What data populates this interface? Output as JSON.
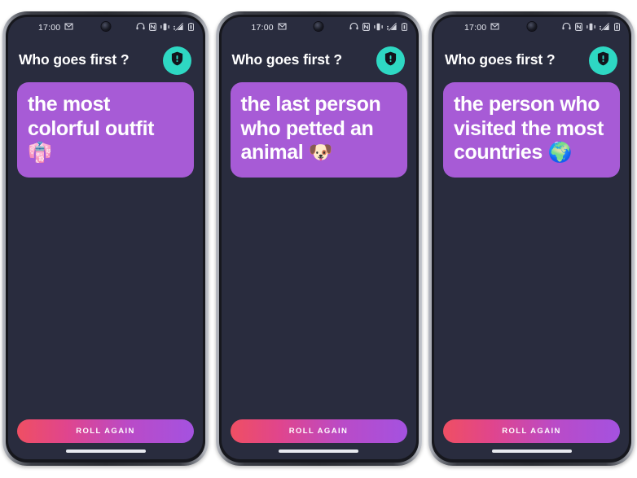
{
  "app": {
    "title": "Who goes first ?",
    "background_color": "#292c3e",
    "card_color": "#a75bd6",
    "badge_color": "#2ed8c3",
    "button_gradient_from": "#ef4f63",
    "button_gradient_to": "#a452e0"
  },
  "status_bar": {
    "time": "17:00",
    "left_icons": [
      "message-icon"
    ],
    "right_icons": [
      "headset-icon",
      "nfc-icon",
      "vibrate-icon",
      "signal-icon",
      "battery-icon"
    ]
  },
  "header": {
    "title": "Who goes first ?",
    "badge_icon": "shield-alert-icon"
  },
  "bottom": {
    "roll_again_label": "ROLL AGAIN"
  },
  "phones": [
    {
      "id": "phone-1",
      "status_time": "17:00",
      "title": "Who goes first ?",
      "card_text": "the most colorful outfit ",
      "card_emoji": "👘",
      "card_emoji_name": "kimono-emoji",
      "roll_again_label": "ROLL AGAIN"
    },
    {
      "id": "phone-2",
      "status_time": "17:00",
      "title": "Who goes first ?",
      "card_text": "the last person who petted an animal ",
      "card_emoji": "🐶",
      "card_emoji_name": "dog-face-emoji",
      "roll_again_label": "ROLL AGAIN"
    },
    {
      "id": "phone-3",
      "status_time": "17:00",
      "title": "Who goes first ?",
      "card_text": "the person who visited the most countries ",
      "card_emoji": "🌍",
      "card_emoji_name": "globe-africa-emoji",
      "roll_again_label": "ROLL AGAIN"
    }
  ]
}
